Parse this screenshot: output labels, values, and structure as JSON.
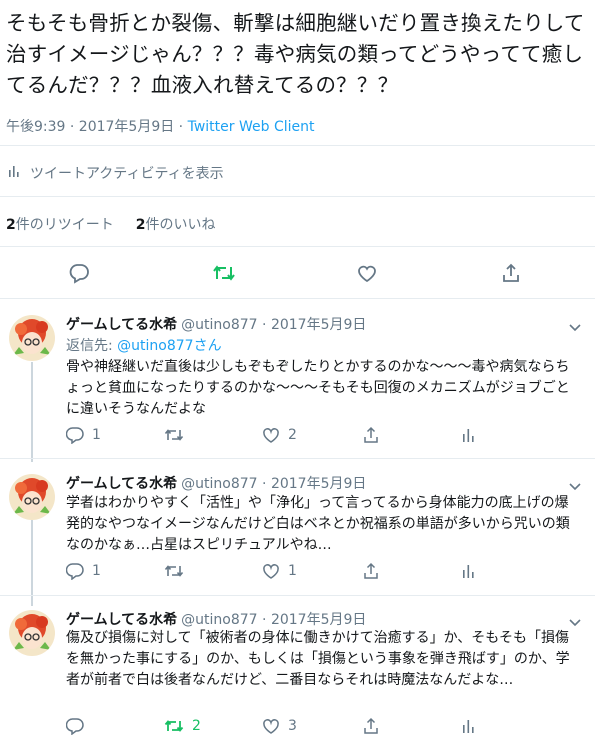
{
  "tweet": {
    "text": "そもそも骨折とか裂傷、斬撃は細胞継いだり置き換えたりして治すイメージじゃん？？？毒や病気の類ってどうやってて癒してるんだ？？？血液入れ替えてるの？？？",
    "time": "午後9:39 · 2017年5月9日 · ",
    "client": "Twitter Web Client",
    "activity_label": "ツイートアクティビティを表示",
    "retweet_count": "2",
    "retweet_label": "件のリツイート",
    "like_count": "2",
    "like_label": "件のいいね"
  },
  "icons": {
    "reply": "reply-icon",
    "retweet": "retweet-icon",
    "like": "heart-icon",
    "share": "share-icon",
    "analytics": "analytics-icon",
    "caret": "chevron-down-icon"
  },
  "colors": {
    "accent": "#1da1f2",
    "retweet": "#17bf63",
    "muted": "#657786"
  },
  "replies": [
    {
      "name": "ゲームしてる水希",
      "handle": "@utino877",
      "date": " · 2017年5月9日",
      "reply_to_label": "返信先: ",
      "reply_to_user": "@utino877",
      "reply_to_suffix": "さん",
      "text": "骨や神経継いだ直後は少しもぞもぞしたりとかするのかな〜〜〜毒や病気ならちょっと貧血になったりするのかな〜〜〜そもそも回復のメカニズムがジョブごとに違いそうなんだよな",
      "reply_count": "1",
      "retweet_count": "",
      "like_count": "2"
    },
    {
      "name": "ゲームしてる水希",
      "handle": "@utino877",
      "date": " · 2017年5月9日",
      "text": "学者はわかりやすく「活性」や「浄化」って言ってるから身体能力の底上げの爆発的なやつなイメージなんだけど白はベネとか祝福系の単語が多いから咒いの類なのかなぁ…占星はスピリチュアルやね…",
      "reply_count": "1",
      "retweet_count": "",
      "like_count": "1"
    },
    {
      "name": "ゲームしてる水希",
      "handle": "@utino877",
      "date": " · 2017年5月9日",
      "text": "傷及び損傷に対して「被術者の身体に働きかけて治癒する」か、そもそも「損傷を無かった事にする」のか、もしくは「損傷という事象を弾き飛ばす」のか、学者が前者で白は後者なんだけど、二番目ならそれは時魔法なんだよな…",
      "reply_count": "",
      "retweet_count": "2",
      "like_count": "3"
    }
  ]
}
